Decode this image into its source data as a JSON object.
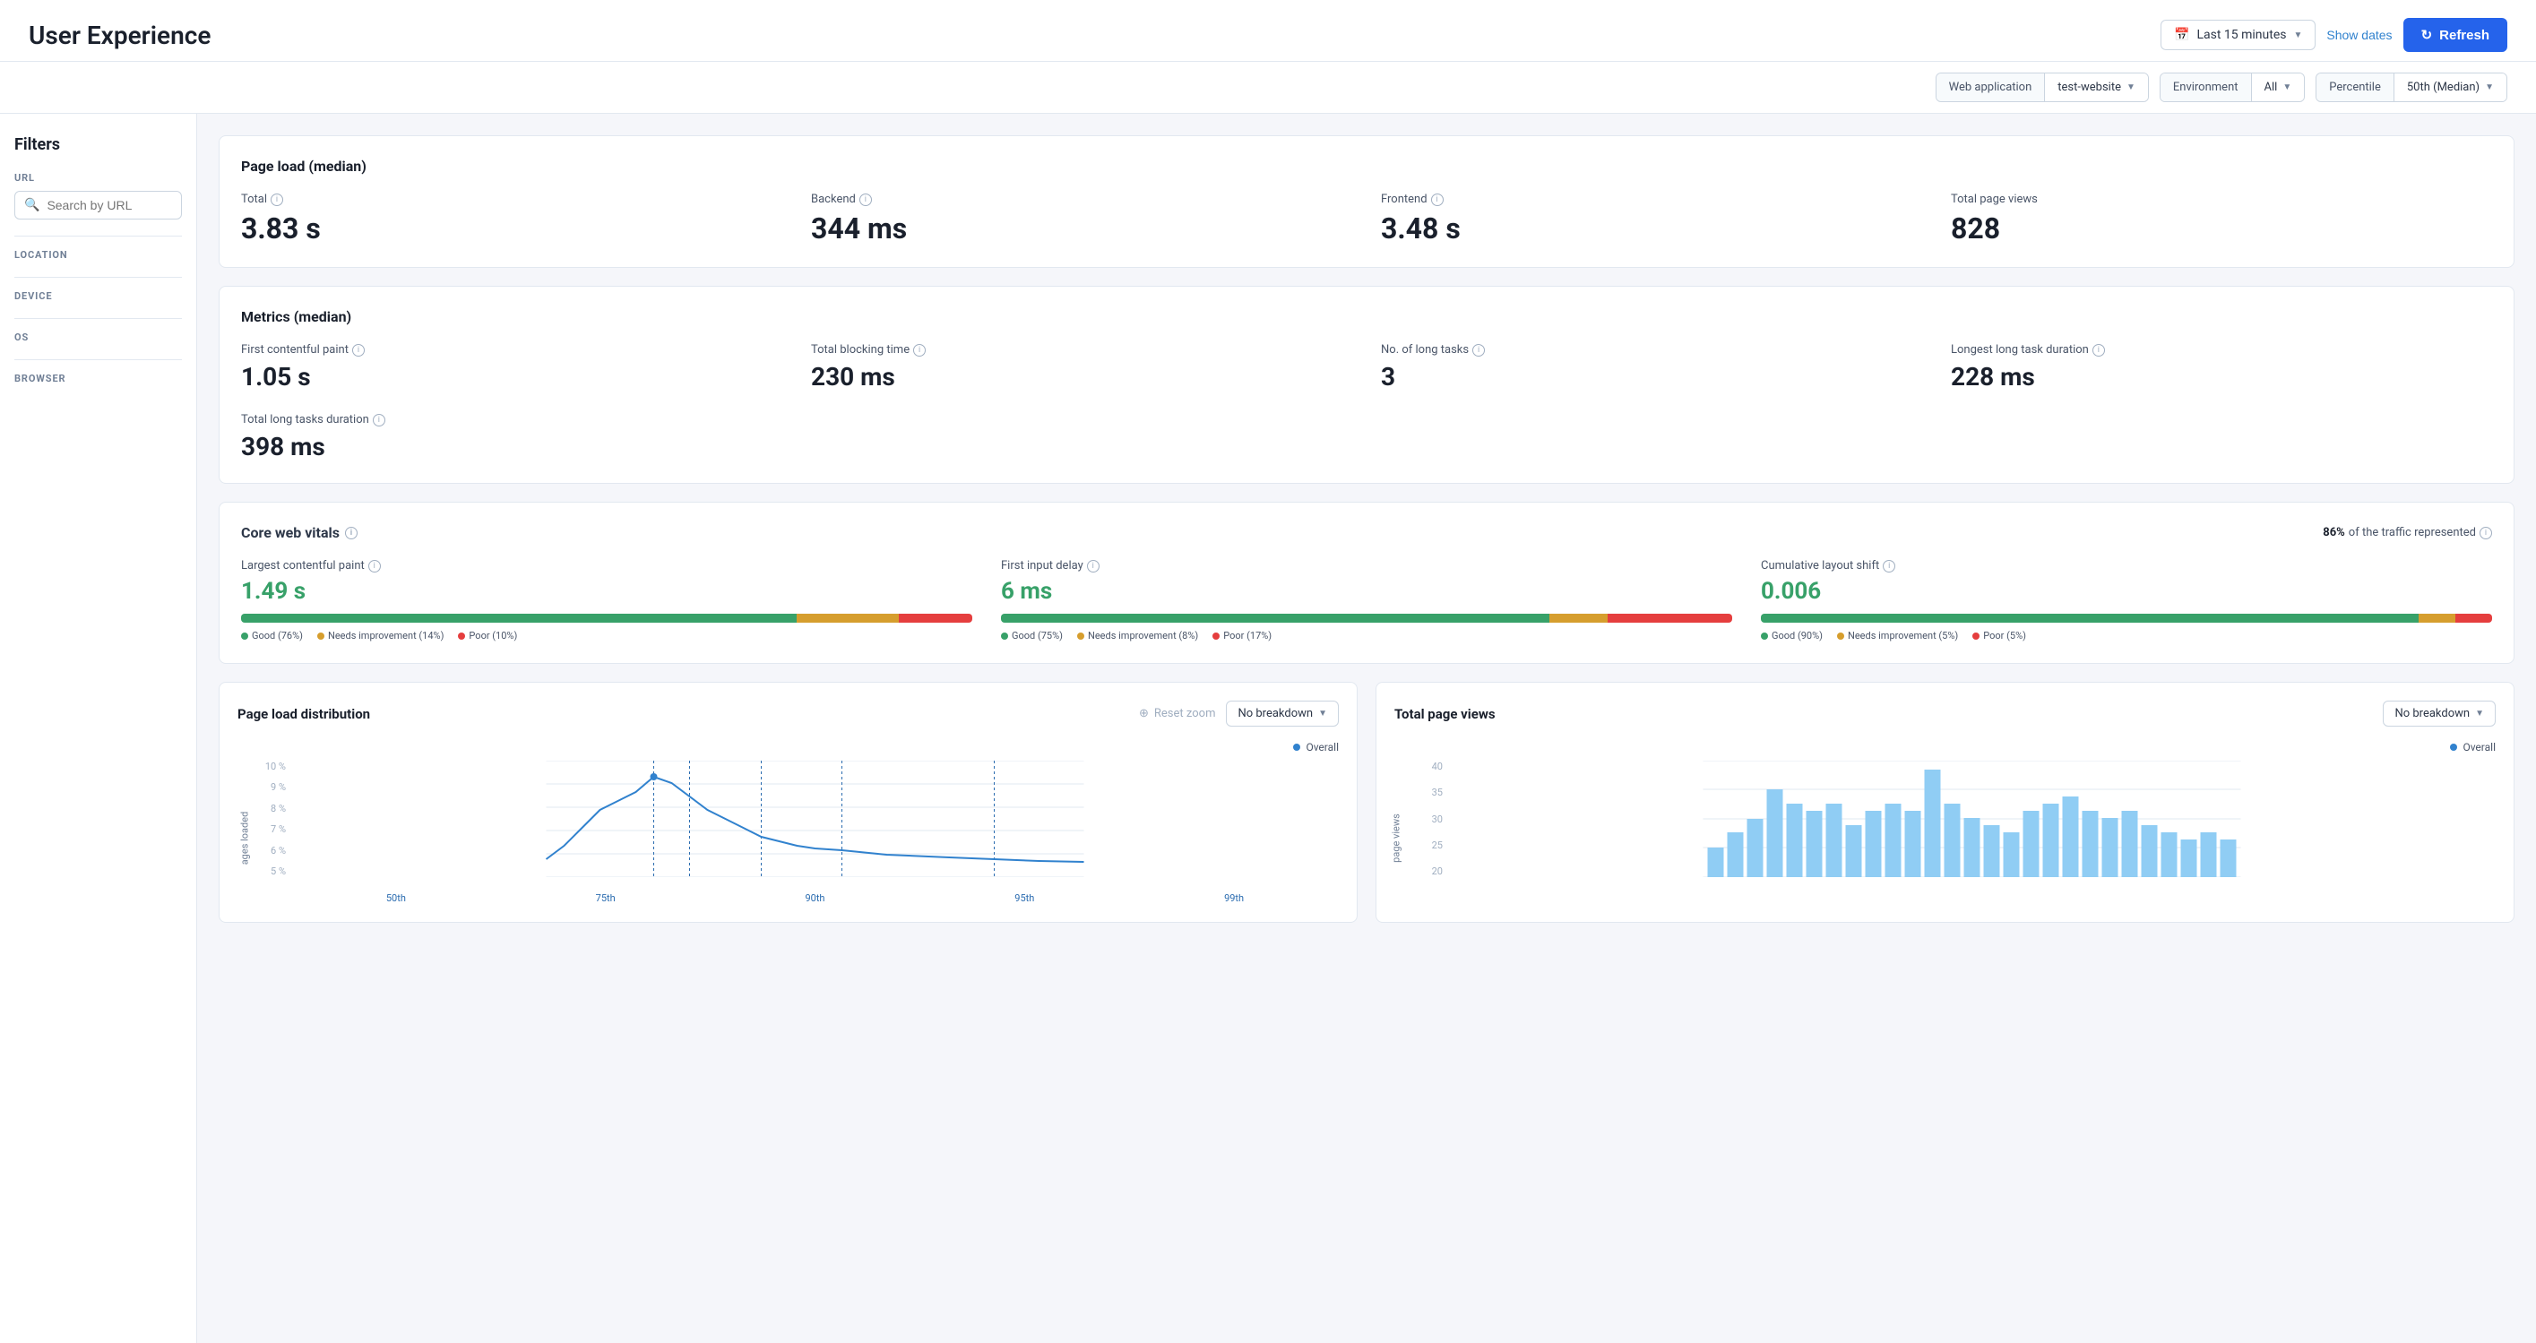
{
  "header": {
    "title": "User Experience",
    "time_range": "Last 15 minutes",
    "show_dates": "Show dates",
    "refresh": "Refresh"
  },
  "filters_bar": {
    "web_app_label": "Web application",
    "web_app_value": "test-website",
    "environment_label": "Environment",
    "environment_value": "All",
    "percentile_label": "Percentile",
    "percentile_value": "50th (Median)"
  },
  "sidebar": {
    "title": "Filters",
    "url_label": "URL",
    "url_placeholder": "Search by URL",
    "location_label": "LOCATION",
    "device_label": "DEVICE",
    "os_label": "OS",
    "browser_label": "BROWSER"
  },
  "page_load": {
    "title": "Page load (median)",
    "metrics": [
      {
        "label": "Total",
        "value": "3.83 s"
      },
      {
        "label": "Backend",
        "value": "344 ms"
      },
      {
        "label": "Frontend",
        "value": "3.48 s"
      },
      {
        "label": "Total page views",
        "value": "828"
      }
    ]
  },
  "metrics_median": {
    "title": "Metrics (median)",
    "metrics": [
      {
        "label": "First contentful paint",
        "value": "1.05 s"
      },
      {
        "label": "Total blocking time",
        "value": "230 ms"
      },
      {
        "label": "No. of long tasks",
        "value": "3"
      },
      {
        "label": "Longest long task duration",
        "value": "228 ms"
      }
    ],
    "extra": {
      "label": "Total long tasks duration",
      "value": "398 ms"
    }
  },
  "core_web_vitals": {
    "title": "Core web vitals",
    "traffic_pct": "86%",
    "traffic_label": "of the traffic represented",
    "items": [
      {
        "label": "Largest contentful paint",
        "value": "1.49 s",
        "good_pct": 76,
        "needs_pct": 14,
        "poor_pct": 10,
        "good_label": "Good (76%)",
        "needs_label": "Needs improvement (14%)",
        "poor_label": "Poor (10%)"
      },
      {
        "label": "First input delay",
        "value": "6 ms",
        "good_pct": 75,
        "needs_pct": 8,
        "poor_pct": 17,
        "good_label": "Good (75%)",
        "needs_label": "Needs improvement (8%)",
        "poor_label": "Poor (17%)"
      },
      {
        "label": "Cumulative layout shift",
        "value": "0.006",
        "good_pct": 90,
        "needs_pct": 5,
        "poor_pct": 5,
        "good_label": "Good (90%)",
        "needs_label": "Needs improvement (5%)",
        "poor_label": "Poor (5%)"
      }
    ]
  },
  "page_load_dist": {
    "title": "Page load distribution",
    "reset_zoom": "Reset zoom",
    "breakdown_label": "No breakdown",
    "overall_label": "Overall",
    "x_labels": [
      "50th",
      "75th",
      "90th",
      "95th",
      "99th"
    ],
    "y_labels": [
      "10 %",
      "9 %",
      "8 %",
      "7 %",
      "6 %",
      "5 %"
    ],
    "vertical_axis_label": "ages loaded"
  },
  "total_page_views": {
    "title": "Total page views",
    "breakdown_label": "No breakdown",
    "overall_label": "Overall",
    "y_labels": [
      "40",
      "35",
      "30",
      "25",
      "20"
    ],
    "vertical_axis_label": "page views"
  }
}
